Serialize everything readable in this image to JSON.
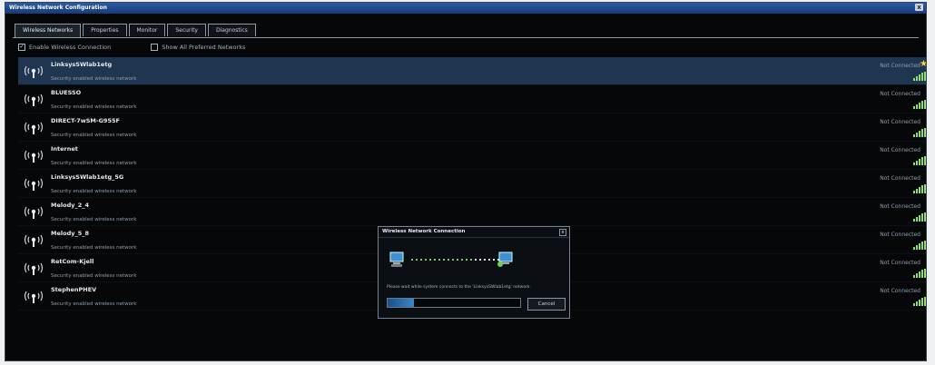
{
  "window": {
    "title": "Wireless Network Configuration",
    "close": "x"
  },
  "tabs": [
    {
      "label": "Wireless Networks",
      "active": true
    },
    {
      "label": "Properties",
      "active": false
    },
    {
      "label": "Monitor",
      "active": false
    },
    {
      "label": "Security",
      "active": false
    },
    {
      "label": "Diagnostics",
      "active": false
    }
  ],
  "options": {
    "enable_wireless": {
      "label": "Enable Wireless Connection",
      "checked": true
    },
    "show_preferred": {
      "label": "Show All Preferred Networks",
      "checked": false
    }
  },
  "networks": [
    {
      "name": "LinksysSWlab1etg",
      "desc": "Security enabled wireless network",
      "status": "Not Connected",
      "selected": true,
      "preferred": true
    },
    {
      "name": "BLUESSO",
      "desc": "Security enabled wireless network",
      "status": "Not Connected",
      "selected": false,
      "preferred": false
    },
    {
      "name": "DIRECT-7wSM-G955F",
      "desc": "Security enabled wireless network",
      "status": "Not Connected",
      "selected": false,
      "preferred": false
    },
    {
      "name": "Internet",
      "desc": "Security enabled wireless network",
      "status": "Not Connected",
      "selected": false,
      "preferred": false
    },
    {
      "name": "LinksysSWlab1etg_5G",
      "desc": "Security enabled wireless network",
      "status": "Not Connected",
      "selected": false,
      "preferred": false
    },
    {
      "name": "Melody_2_4",
      "desc": "Security enabled wireless network",
      "status": "Not Connected",
      "selected": false,
      "preferred": false
    },
    {
      "name": "Melody_5_8",
      "desc": "Security enabled wireless network",
      "status": "Not Connected",
      "selected": false,
      "preferred": false
    },
    {
      "name": "RetCom-Kjell",
      "desc": "Security enabled wireless network",
      "status": "Not Connected",
      "selected": false,
      "preferred": false
    },
    {
      "name": "StephenPHEV",
      "desc": "Security enabled wireless network",
      "status": "Not Connected",
      "selected": false,
      "preferred": false
    }
  ],
  "icons": {
    "network": "antenna-icon",
    "signal": "signal-strength-icon",
    "star": "star-icon"
  },
  "dialog": {
    "title": "Wireless Network Connection",
    "message": "Please wait while system connects to the 'LinksysSWlab1etg' network.",
    "cancel_label": "Cancel",
    "progress_fraction": 0.2
  },
  "colors": {
    "selected_row": "#1e3650",
    "signal": "#8be06b",
    "star": "#ffd23c"
  }
}
